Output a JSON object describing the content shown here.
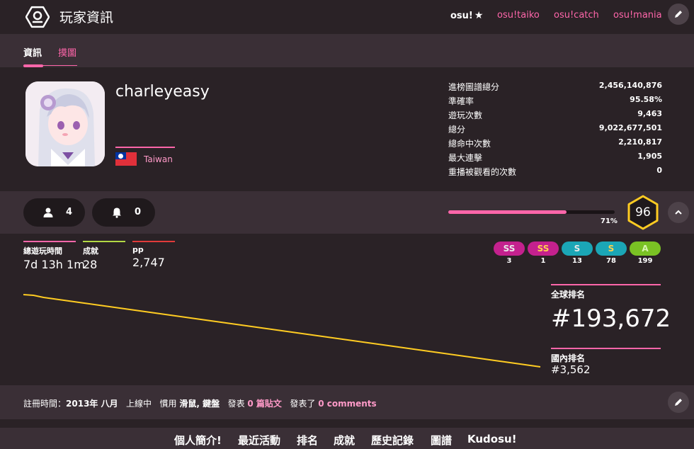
{
  "header": {
    "title": "玩家資訊",
    "modes": {
      "osu": "osu!",
      "taiko": "osu!taiko",
      "catch": "osu!catch",
      "mania": "osu!mania"
    }
  },
  "tabs": {
    "info": "資訊",
    "fanart": "摸圖"
  },
  "profile": {
    "username": "charleyeasy",
    "country": "Taiwan",
    "stats": [
      {
        "label": "進榜圖譜總分",
        "value": "2,456,140,876"
      },
      {
        "label": "準確率",
        "value": "95.58%"
      },
      {
        "label": "遊玩次數",
        "value": "9,463"
      },
      {
        "label": "總分",
        "value": "9,022,677,501"
      },
      {
        "label": "總命中次數",
        "value": "2,210,817"
      },
      {
        "label": "最大連擊",
        "value": "1,905"
      },
      {
        "label": "重播被觀看的次數",
        "value": "0"
      }
    ]
  },
  "social": {
    "followers": "4",
    "mapping_subscribers": "0"
  },
  "level": {
    "progress_pct": 71,
    "progress_label": "71%",
    "level": "96"
  },
  "summary": {
    "playtime_label": "總遊玩時間",
    "playtime_value": "7d 13h 1m",
    "medals_label": "成就",
    "medals_value": "28",
    "pp_label": "pp",
    "pp_value": "2,747"
  },
  "grades": [
    {
      "label": "SS",
      "count": "3",
      "bg": "#c4218e",
      "fg": "#e8e8e8"
    },
    {
      "label": "SS",
      "count": "1",
      "bg": "#c4218e",
      "fg": "#ffd24d"
    },
    {
      "label": "S",
      "count": "13",
      "bg": "#1ba6b6",
      "fg": "#e8e8e8"
    },
    {
      "label": "S",
      "count": "78",
      "bg": "#1ba6b6",
      "fg": "#ffd24d"
    },
    {
      "label": "A",
      "count": "199",
      "bg": "#7ac224",
      "fg": "#d8f5b0"
    }
  ],
  "ranks": {
    "global_label": "全球排名",
    "global_value": "#193,672",
    "country_label": "國內排名",
    "country_value": "#3,562"
  },
  "rank_history": [
    8,
    9,
    12,
    14,
    16,
    18,
    20,
    22,
    24,
    26,
    28,
    30,
    32,
    34,
    36,
    38,
    40,
    42,
    44,
    46,
    48,
    50,
    52,
    54,
    56,
    58,
    60,
    62,
    64,
    66,
    68,
    70,
    72,
    74,
    76,
    78,
    80,
    82,
    84,
    86,
    88,
    90,
    92,
    94,
    96,
    98,
    100,
    102,
    104,
    106,
    108,
    110
  ],
  "info": {
    "joined_label": "註冊時間：",
    "joined_value": "2013年 八月",
    "status": "上線中",
    "playstyle_label": "慣用",
    "playstyle_value": "滑鼠, 鍵盤",
    "posts_prefix": "發表",
    "posts_value": "0 篇貼文",
    "comments_prefix": "發表了",
    "comments_value": "0 comments"
  },
  "bottom_nav": [
    "個人簡介!",
    "最近活動",
    "排名",
    "成就",
    "歷史記錄",
    "圖譜",
    "Kudosu!"
  ],
  "colors": {
    "accent": "#ff66aa",
    "level_ring": "#ffcc22",
    "graph_line": "#ffcc22"
  }
}
